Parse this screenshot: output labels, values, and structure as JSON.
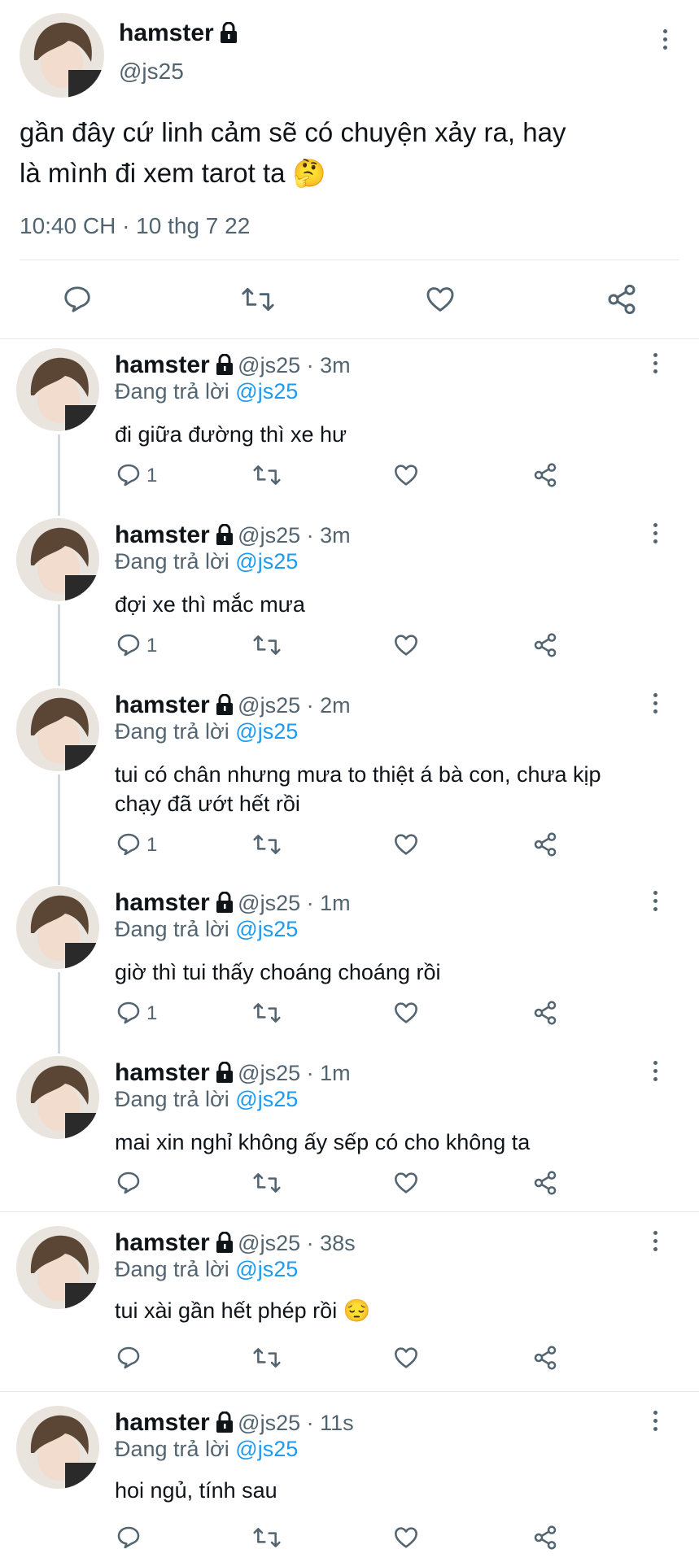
{
  "main_tweet": {
    "name": "hamster",
    "handle": "@js25",
    "text_line1": "gần đây cứ linh cảm sẽ có chuyện xảy ra, hay",
    "text_line2": "là mình đi xem tarot ta 🤔",
    "timestamp": "10:40 CH · 10 thg 7 22"
  },
  "replies": [
    {
      "name": "hamster",
      "meta": "@js25 · 3m",
      "replying_prefix": "Đang trả lời",
      "replying_handle": "@js25",
      "text": "đi giữa đường thì xe hư",
      "reply_count": "1"
    },
    {
      "name": "hamster",
      "meta": "@js25 · 3m",
      "replying_prefix": "Đang trả lời",
      "replying_handle": "@js25",
      "text": "đợi xe thì mắc mưa",
      "reply_count": "1"
    },
    {
      "name": "hamster",
      "meta": "@js25 · 2m",
      "replying_prefix": "Đang trả lời",
      "replying_handle": "@js25",
      "text_line1": "tui có chân nhưng mưa to thiệt á bà con, chưa kịp",
      "text_line2": "chạy đã ướt hết rồi",
      "reply_count": "1"
    },
    {
      "name": "hamster",
      "meta": "@js25 · 1m",
      "replying_prefix": "Đang trả lời",
      "replying_handle": "@js25",
      "text": "giờ thì tui thấy choáng choáng rồi",
      "reply_count": "1"
    },
    {
      "name": "hamster",
      "meta": "@js25 · 1m",
      "replying_prefix": "Đang trả lời",
      "replying_handle": "@js25",
      "text": "mai xin nghỉ không ấy sếp có cho không ta",
      "reply_count": ""
    },
    {
      "name": "hamster",
      "meta": "@js25 · 38s",
      "replying_prefix": "Đang trả lời",
      "replying_handle": "@js25",
      "text": "tui xài gần hết phép rồi 😔",
      "reply_count": ""
    },
    {
      "name": "hamster",
      "meta": "@js25 · 11s",
      "replying_prefix": "Đang trả lời",
      "replying_handle": "@js25",
      "text": "hoi ngủ, tính sau",
      "reply_count": ""
    }
  ],
  "colors": {
    "text": "#0f1419",
    "secondary": "#536471",
    "mention": "#1d9bf0",
    "divider": "#e6e9ec"
  }
}
